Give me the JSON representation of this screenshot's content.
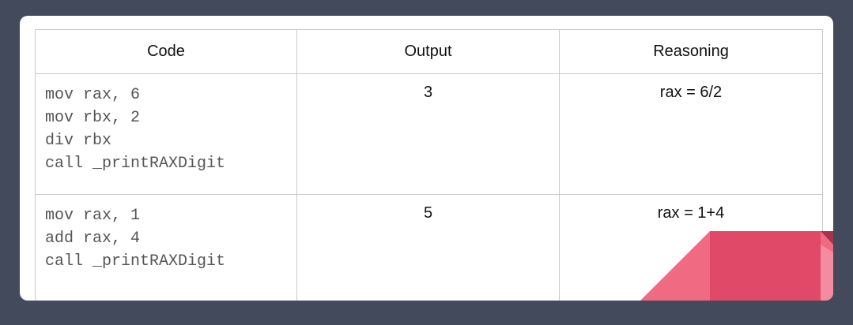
{
  "table": {
    "headers": [
      "Code",
      "Output",
      "Reasoning"
    ],
    "rows": [
      {
        "code": [
          "mov rax, 6",
          "mov rbx, 2",
          "div rbx",
          "call _printRAXDigit"
        ],
        "output": "3",
        "reasoning": "rax = 6/2"
      },
      {
        "code": [
          "mov rax, 1",
          "add rax, 4",
          "call _printRAXDigit"
        ],
        "output": "5",
        "reasoning": "rax = 1+4"
      }
    ]
  },
  "colors": {
    "background": "#434a5c",
    "card": "#ffffff",
    "grid": "#c9c9c9",
    "accent_pink": "#f06a82",
    "accent_red": "#e04a68"
  }
}
